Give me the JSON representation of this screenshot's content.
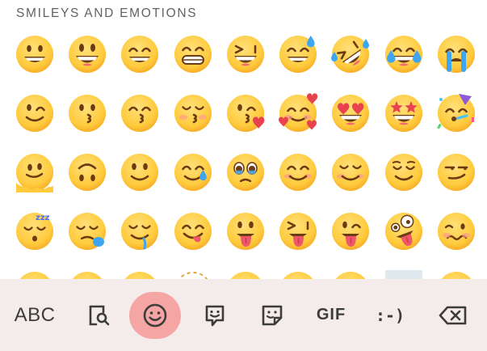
{
  "section": {
    "title": "SMILEYS AND EMOTIONS"
  },
  "colors": {
    "toolbar_bg": "#f3ecea",
    "active_pill": "#f5a5a3",
    "face_yellow": "#ffcb3d",
    "face_shade": "#f5a623",
    "icon": "#3c3c3c"
  },
  "emoji_rows": [
    [
      "grinning-face",
      "grinning-face-big-eyes",
      "grinning-face-smiling-eyes",
      "beaming-face",
      "grinning-squinting-face",
      "grinning-face-with-sweat",
      "rolling-on-floor-laughing",
      "face-with-tears-of-joy",
      "loudly-crying-face"
    ],
    [
      "winking-face",
      "kissing-face",
      "kissing-face-smiling-eyes",
      "kissing-face-closed-eyes",
      "face-blowing-kiss",
      "smiling-face-with-hearts",
      "smiling-face-with-heart-eyes",
      "star-struck",
      "partying-face"
    ],
    [
      "melting-face",
      "upside-down-face",
      "slightly-smiling-face",
      "smiling-face-with-tear",
      "face-holding-back-tears",
      "smiling-face-smiling-eyes",
      "smiling-face",
      "relieved-face",
      "smirking-face"
    ],
    [
      "sleeping-face",
      "sleepy-face",
      "drooling-face",
      "face-savoring-food",
      "face-with-tongue",
      "squinting-face-with-tongue",
      "winking-face-with-tongue",
      "zany-face",
      "woozy-face"
    ],
    [
      "partial-face",
      "partial-face",
      "partial-face",
      "dotted-line-face",
      "partial-face",
      "partial-face",
      "partial-face",
      "partial-face-frame",
      "partial-face"
    ]
  ],
  "toolbar": {
    "abc_label": "ABC",
    "gif_label": "GIF",
    "emoticon_label": ":-)",
    "icons": [
      "search-emoji-icon",
      "emoji-icon",
      "sticker-icon",
      "avatar-sticker-icon",
      "backspace-icon"
    ]
  }
}
